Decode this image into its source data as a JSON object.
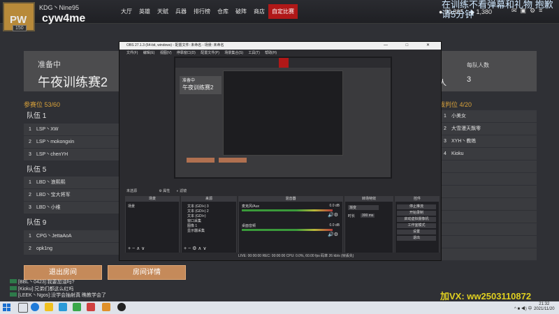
{
  "header": {
    "team_title": "KDG丶Nine95",
    "username": "cyw4me",
    "overlay_prefix": "PW",
    "level": "150",
    "nav": [
      "大厅",
      "英雄",
      "天赋",
      "兵器",
      "排行榜",
      "仓库",
      "破阵",
      "商店",
      "自定比赛"
    ],
    "active_nav": "自定比赛",
    "currency_1": "90,895",
    "currency_2": "1,380",
    "overlay_text": "在训练不看弹幕和礼物 抱歉 请5分钟",
    "hud_icons": [
      "mail-icon",
      "shop-icon",
      "settings-icon",
      "menu-icon"
    ]
  },
  "room": {
    "status": "准备中",
    "name": "午夜训练赛2",
    "per_team_label": "每队人数",
    "per_team_value": "3",
    "ren_char": "人"
  },
  "participants": {
    "label": "参赛位 53/60",
    "teams": [
      {
        "name": "队伍 1",
        "players": [
          {
            "n": "1",
            "name": "LSP丶XW"
          },
          {
            "n": "2",
            "name": "LSP丶mokongxin"
          },
          {
            "n": "3",
            "name": "LSP丶chenYH"
          }
        ]
      },
      {
        "name": "队伍 5",
        "players": [
          {
            "n": "1",
            "name": "LBD丶浪熙熙"
          },
          {
            "n": "2",
            "name": "LBD丶宝大将军"
          },
          {
            "n": "3",
            "name": "LBD丶小维"
          }
        ]
      },
      {
        "name": "队伍 9",
        "players": [
          {
            "n": "1",
            "name": "CPG丶JettaAoA"
          },
          {
            "n": "2",
            "name": "opk1ng"
          }
        ]
      }
    ]
  },
  "referees": {
    "label": "裁判位 4/20",
    "rows": [
      {
        "n": "1",
        "name": "小美女"
      },
      {
        "n": "2",
        "name": "大雪漫天飘零"
      },
      {
        "n": "3",
        "name": "XYH丶教练"
      },
      {
        "n": "4",
        "name": "Kioku"
      }
    ]
  },
  "buttons": {
    "exit_room": "退出房间",
    "room_details": "房间详情"
  },
  "chat": [
    {
      "text": "[BBL丶0423]:我要加油吗?"
    },
    {
      "text": "[Kioku]:兄弟们都这么红吗"
    },
    {
      "text": "[LEEK丶Ngos]:没学会抽射真 瞧教学会了"
    }
  ],
  "ad_text": "加VX: ww2503110872",
  "taskbar": {
    "time": "21:32",
    "date": "2021/11/20",
    "tray_text": "^ ■ ◀) 中"
  },
  "obs": {
    "title": "OBS 27.1.3 (64-bit, windows) - 配置文件: 未命名 - 场景: 未命名",
    "controls": "— □ ✕",
    "menu": [
      "文件(F)",
      "编辑(E)",
      "视图(V)",
      "停靠窗口(D)",
      "配置文件(P)",
      "场景集合(S)",
      "工具(T)",
      "帮助(H)"
    ],
    "preview_title": "准备中",
    "preview_room": "午夜训练赛2",
    "scene_label": "未选源",
    "scene_buttons": [
      "属性",
      "滤镜"
    ],
    "docks": {
      "scenes": {
        "title": "场景",
        "items": [
          "场景"
        ]
      },
      "sources": {
        "title": "来源",
        "items": [
          "文本 (GDI+) 3",
          "文本 (GDI+) 2",
          "文本 (GDI+)",
          "窗口采集",
          "图像 1",
          "显示器采集"
        ]
      },
      "mixer": {
        "title": "混音器",
        "tracks": [
          {
            "name": "麦克风/Aux",
            "db": "0.0 dB"
          },
          {
            "name": "桌面音频",
            "db": "0.0 dB"
          }
        ]
      },
      "transitions": {
        "title": "转场特效",
        "type": "渐变",
        "duration_label": "时长",
        "duration": "300 ms"
      },
      "controls": {
        "title": "控件",
        "buttons": [
          "停止推流",
          "开始录制",
          "启动虚拟摄像机",
          "工作室模式",
          "设置",
          "退出"
        ]
      }
    },
    "status": "LIVE: 00:00:00   REC: 00:00:00   CPU: 0.0%, 60.00 fps   码率 26 kb/s (帧丢失)"
  }
}
